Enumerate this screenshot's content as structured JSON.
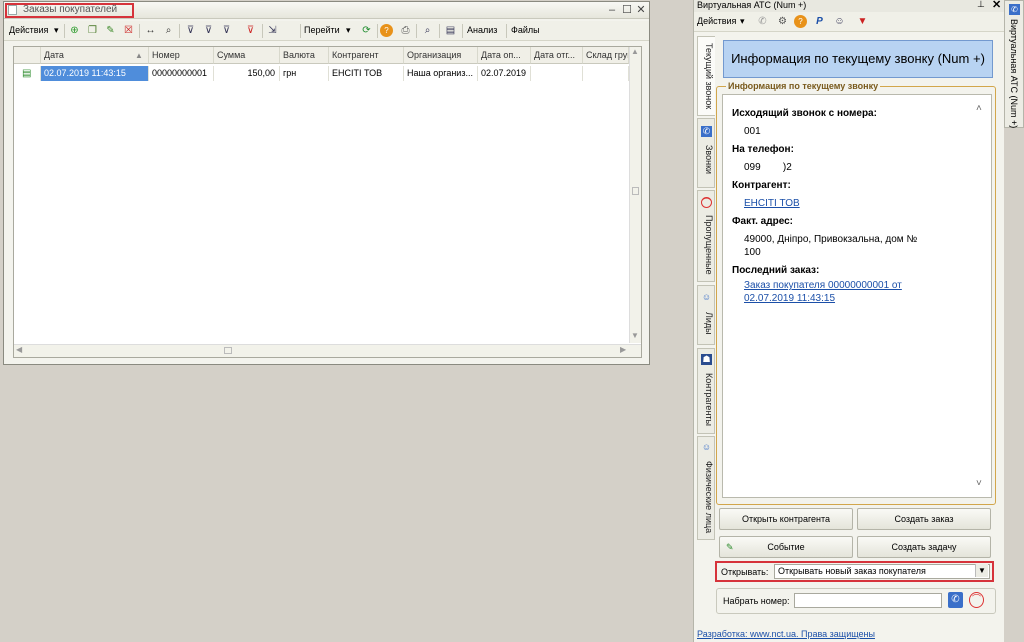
{
  "orders_window": {
    "title": "Заказы покупателей",
    "toolbar": {
      "actions": "Действия",
      "goto": "Перейти",
      "analysis": "Анализ",
      "files": "Файлы"
    },
    "columns": [
      "Дата",
      "Номер",
      "Сумма",
      "Валюта",
      "Контрагент",
      "Организация",
      "Дата оп...",
      "Дата отг...",
      "Склад груп"
    ],
    "rows": [
      [
        "02.07.2019 11:43:15",
        "00000000001",
        "150,00",
        "грн",
        "ЕНСІТІ ТОВ",
        "Наша организ...",
        "02.07.2019",
        "",
        ""
      ]
    ]
  },
  "atc_panel": {
    "title": "Виртуальная АТС (Num +)",
    "toolbar": {
      "actions": "Действия"
    },
    "tabs": [
      "Текущий звонок",
      "Звонки",
      "Пропущенные",
      "Лиды",
      "Контрагенты",
      "Физические лица"
    ],
    "headline": "Информация по текущему звонку (Num +)",
    "group_title": "Информация по текущему звонку",
    "info": {
      "incoming_label": "Исходящий звонок с номера:",
      "incoming_value": "001",
      "phone_label": "На телефон:",
      "phone_value": "099        )2",
      "counterparty_label": "Контрагент:",
      "counterparty_value": "ЕНСІТІ ТОВ",
      "address_label": "Факт. адрес:",
      "address_line1": "49000, Дніпро, Привокзальна, дом №",
      "address_line2": "100",
      "last_order_label": "Последний заказ:",
      "last_order_line1": "Заказ покупателя 00000000001 от",
      "last_order_line2": "02.07.2019 11:43:15"
    },
    "buttons": {
      "open_counterparty": "Открыть контрагента",
      "create_order": "Создать заказ",
      "event": "Событие",
      "create_task": "Создать задачу"
    },
    "open_label": "Открывать:",
    "open_value": "Открывать новый заказ покупателя",
    "dial_label": "Набрать номер:",
    "dial_value": "",
    "footer": "Разработка: www.nct.ua. Права защищены"
  },
  "side_strip": {
    "label": "Виртуальная АТС (Num +)"
  }
}
